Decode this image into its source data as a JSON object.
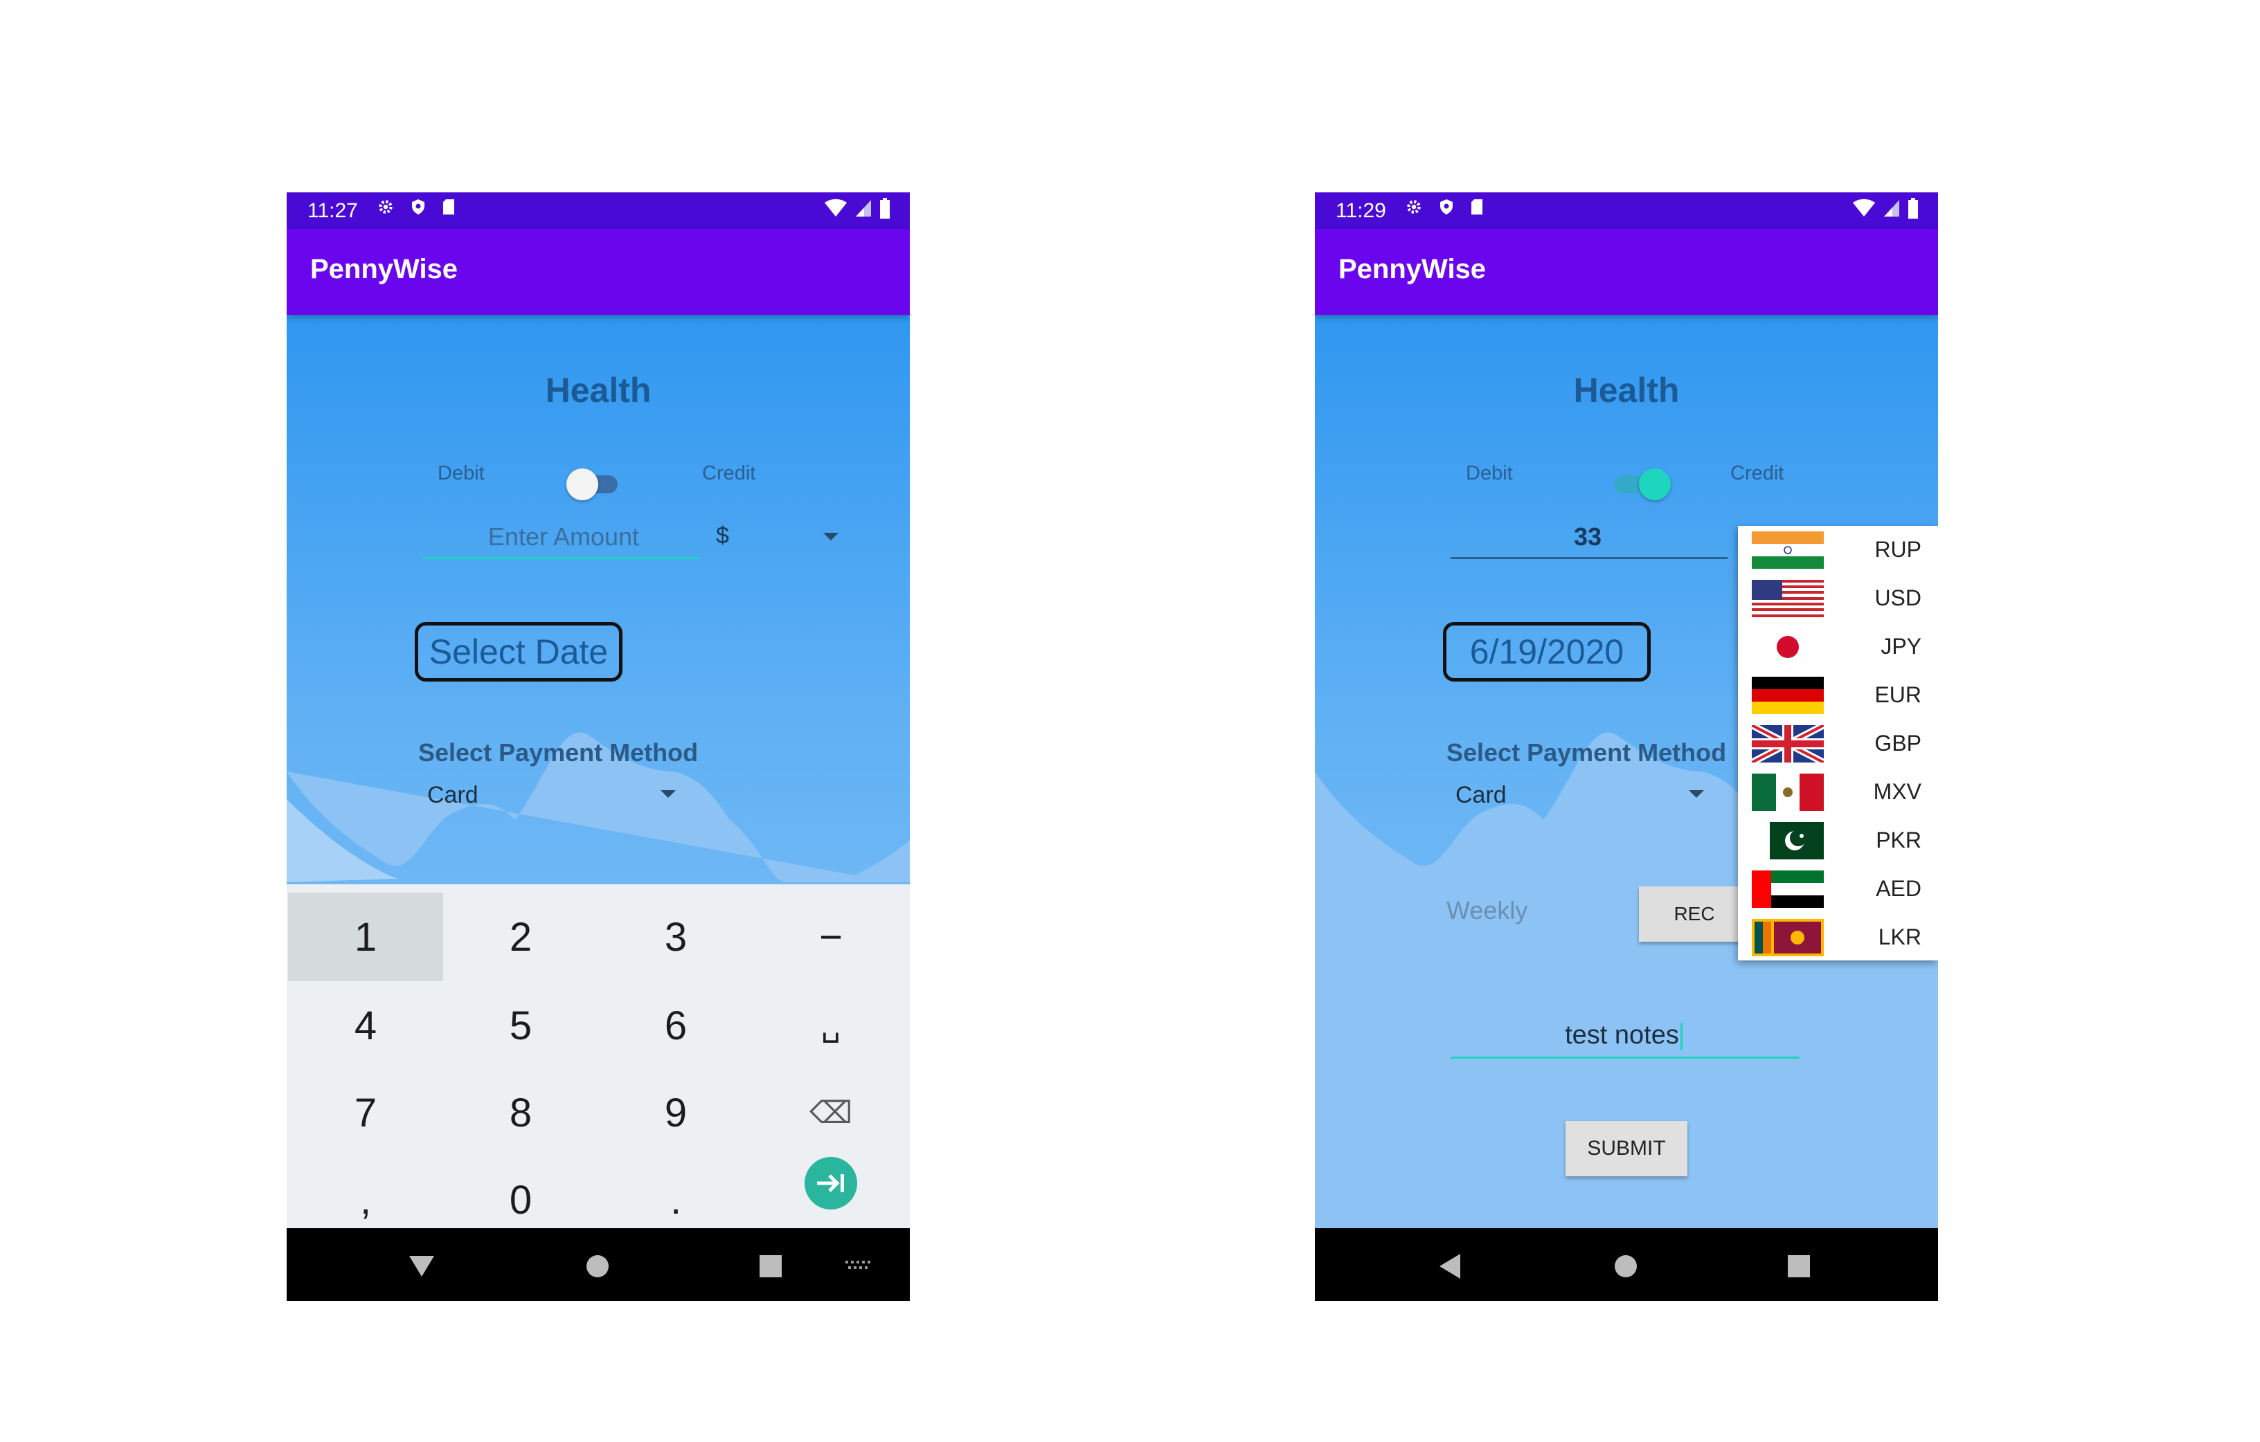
{
  "left_screen": {
    "status": {
      "time": "11:27"
    },
    "app_title": "PennyWise",
    "heading": "Health",
    "toggle": {
      "left_label": "Debit",
      "right_label": "Credit",
      "on": false
    },
    "amount": {
      "placeholder": "Enter Amount",
      "currency_symbol": "$"
    },
    "date_button": "Select Date",
    "payment": {
      "label": "Select Payment Method",
      "value": "Card"
    },
    "keyboard": {
      "keys": [
        "1",
        "2",
        "3",
        "−",
        "4",
        "5",
        "6",
        "␣",
        "7",
        "8",
        "9",
        "⌫",
        ",",
        "0",
        "."
      ]
    }
  },
  "right_screen": {
    "status": {
      "time": "11:29"
    },
    "app_title": "PennyWise",
    "heading": "Health",
    "toggle": {
      "left_label": "Debit",
      "right_label": "Credit",
      "on": true
    },
    "amount": {
      "value": "33"
    },
    "date_button": "6/19/2020",
    "payment": {
      "label": "Select Payment Method",
      "value": "Card"
    },
    "recurrence": {
      "value": "Weekly",
      "button": "REC"
    },
    "notes": "test notes",
    "submit": "SUBMIT",
    "currency_dropdown": {
      "options": [
        {
          "code": "RUP",
          "flag": "india-flag"
        },
        {
          "code": "USD",
          "flag": "usa-flag"
        },
        {
          "code": "JPY",
          "flag": "japan-flag"
        },
        {
          "code": "EUR",
          "flag": "germany-flag"
        },
        {
          "code": "GBP",
          "flag": "uk-flag"
        },
        {
          "code": "MXV",
          "flag": "mexico-flag"
        },
        {
          "code": "PKR",
          "flag": "pakistan-flag"
        },
        {
          "code": "AED",
          "flag": "uae-flag"
        },
        {
          "code": "LKR",
          "flag": "sri-lanka-flag"
        }
      ]
    }
  },
  "colors": {
    "status_bar": "#4a0ad6",
    "app_bar": "#6a06ee",
    "accent_teal": "#1ed5c0",
    "enter_key": "#2ab59e"
  }
}
